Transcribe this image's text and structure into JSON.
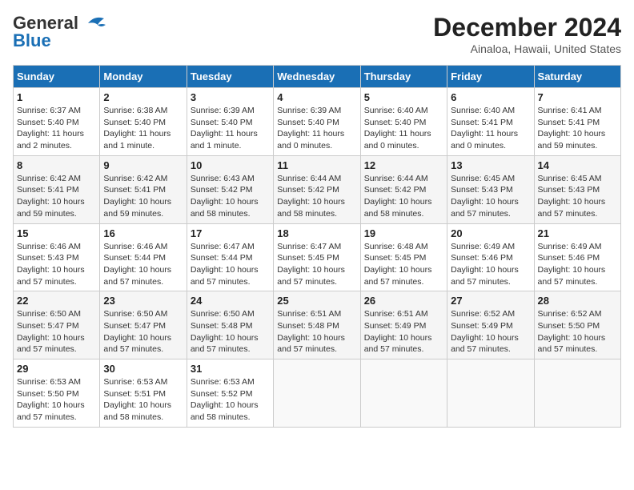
{
  "logo": {
    "line1": "General",
    "line2": "Blue"
  },
  "header": {
    "month": "December 2024",
    "location": "Ainaloa, Hawaii, United States"
  },
  "days_of_week": [
    "Sunday",
    "Monday",
    "Tuesday",
    "Wednesday",
    "Thursday",
    "Friday",
    "Saturday"
  ],
  "weeks": [
    [
      {
        "day": "1",
        "sunrise": "6:37 AM",
        "sunset": "5:40 PM",
        "daylight": "11 hours and 2 minutes."
      },
      {
        "day": "2",
        "sunrise": "6:38 AM",
        "sunset": "5:40 PM",
        "daylight": "11 hours and 1 minute."
      },
      {
        "day": "3",
        "sunrise": "6:39 AM",
        "sunset": "5:40 PM",
        "daylight": "11 hours and 1 minute."
      },
      {
        "day": "4",
        "sunrise": "6:39 AM",
        "sunset": "5:40 PM",
        "daylight": "11 hours and 0 minutes."
      },
      {
        "day": "5",
        "sunrise": "6:40 AM",
        "sunset": "5:40 PM",
        "daylight": "11 hours and 0 minutes."
      },
      {
        "day": "6",
        "sunrise": "6:40 AM",
        "sunset": "5:41 PM",
        "daylight": "11 hours and 0 minutes."
      },
      {
        "day": "7",
        "sunrise": "6:41 AM",
        "sunset": "5:41 PM",
        "daylight": "10 hours and 59 minutes."
      }
    ],
    [
      {
        "day": "8",
        "sunrise": "6:42 AM",
        "sunset": "5:41 PM",
        "daylight": "10 hours and 59 minutes."
      },
      {
        "day": "9",
        "sunrise": "6:42 AM",
        "sunset": "5:41 PM",
        "daylight": "10 hours and 59 minutes."
      },
      {
        "day": "10",
        "sunrise": "6:43 AM",
        "sunset": "5:42 PM",
        "daylight": "10 hours and 58 minutes."
      },
      {
        "day": "11",
        "sunrise": "6:44 AM",
        "sunset": "5:42 PM",
        "daylight": "10 hours and 58 minutes."
      },
      {
        "day": "12",
        "sunrise": "6:44 AM",
        "sunset": "5:42 PM",
        "daylight": "10 hours and 58 minutes."
      },
      {
        "day": "13",
        "sunrise": "6:45 AM",
        "sunset": "5:43 PM",
        "daylight": "10 hours and 57 minutes."
      },
      {
        "day": "14",
        "sunrise": "6:45 AM",
        "sunset": "5:43 PM",
        "daylight": "10 hours and 57 minutes."
      }
    ],
    [
      {
        "day": "15",
        "sunrise": "6:46 AM",
        "sunset": "5:43 PM",
        "daylight": "10 hours and 57 minutes."
      },
      {
        "day": "16",
        "sunrise": "6:46 AM",
        "sunset": "5:44 PM",
        "daylight": "10 hours and 57 minutes."
      },
      {
        "day": "17",
        "sunrise": "6:47 AM",
        "sunset": "5:44 PM",
        "daylight": "10 hours and 57 minutes."
      },
      {
        "day": "18",
        "sunrise": "6:47 AM",
        "sunset": "5:45 PM",
        "daylight": "10 hours and 57 minutes."
      },
      {
        "day": "19",
        "sunrise": "6:48 AM",
        "sunset": "5:45 PM",
        "daylight": "10 hours and 57 minutes."
      },
      {
        "day": "20",
        "sunrise": "6:49 AM",
        "sunset": "5:46 PM",
        "daylight": "10 hours and 57 minutes."
      },
      {
        "day": "21",
        "sunrise": "6:49 AM",
        "sunset": "5:46 PM",
        "daylight": "10 hours and 57 minutes."
      }
    ],
    [
      {
        "day": "22",
        "sunrise": "6:50 AM",
        "sunset": "5:47 PM",
        "daylight": "10 hours and 57 minutes."
      },
      {
        "day": "23",
        "sunrise": "6:50 AM",
        "sunset": "5:47 PM",
        "daylight": "10 hours and 57 minutes."
      },
      {
        "day": "24",
        "sunrise": "6:50 AM",
        "sunset": "5:48 PM",
        "daylight": "10 hours and 57 minutes."
      },
      {
        "day": "25",
        "sunrise": "6:51 AM",
        "sunset": "5:48 PM",
        "daylight": "10 hours and 57 minutes."
      },
      {
        "day": "26",
        "sunrise": "6:51 AM",
        "sunset": "5:49 PM",
        "daylight": "10 hours and 57 minutes."
      },
      {
        "day": "27",
        "sunrise": "6:52 AM",
        "sunset": "5:49 PM",
        "daylight": "10 hours and 57 minutes."
      },
      {
        "day": "28",
        "sunrise": "6:52 AM",
        "sunset": "5:50 PM",
        "daylight": "10 hours and 57 minutes."
      }
    ],
    [
      {
        "day": "29",
        "sunrise": "6:53 AM",
        "sunset": "5:50 PM",
        "daylight": "10 hours and 57 minutes."
      },
      {
        "day": "30",
        "sunrise": "6:53 AM",
        "sunset": "5:51 PM",
        "daylight": "10 hours and 58 minutes."
      },
      {
        "day": "31",
        "sunrise": "6:53 AM",
        "sunset": "5:52 PM",
        "daylight": "10 hours and 58 minutes."
      },
      null,
      null,
      null,
      null
    ]
  ],
  "labels": {
    "sunrise": "Sunrise:",
    "sunset": "Sunset:",
    "daylight": "Daylight:"
  }
}
